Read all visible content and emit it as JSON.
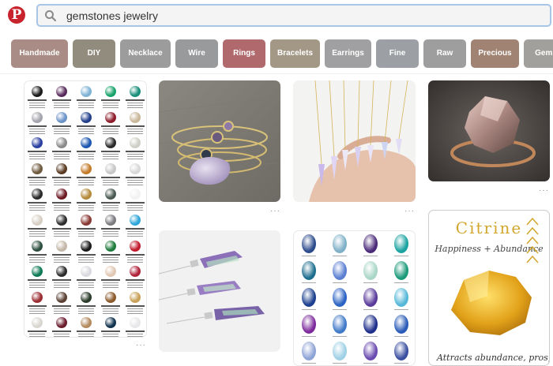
{
  "header": {
    "logo_glyph": "P",
    "search_value": "gemstones jewelry"
  },
  "chips": [
    {
      "label": "Handmade",
      "color": "#a88c85"
    },
    {
      "label": "DIY",
      "color": "#928c7f"
    },
    {
      "label": "Necklace",
      "color": "#9c9c9c"
    },
    {
      "label": "Wire",
      "color": "#999a9c"
    },
    {
      "label": "Rings",
      "color": "#b06a6e"
    },
    {
      "label": "Bracelets",
      "color": "#a39786"
    },
    {
      "label": "Earrings",
      "color": "#a0a0a2"
    },
    {
      "label": "Fine",
      "color": "#9c9fa3"
    },
    {
      "label": "Raw",
      "color": "#9e9e9e"
    },
    {
      "label": "Precious",
      "color": "#a08373"
    },
    {
      "label": "Gem S",
      "color": "#a1a09c"
    }
  ],
  "pins": {
    "citrine_title": "Citrine",
    "citrine_subtitle": "Happiness + Abundance",
    "citrine_caption": "Attracts abundance, prosperity",
    "more_glyph": "···"
  },
  "colors": {
    "accent_red": "#c8232c",
    "search_border": "#a7c5e6"
  },
  "gem_colors": [
    "#1b1b1b",
    "#5a2c5e",
    "#7fb3d6",
    "#1aa36b",
    "#1a8f7a",
    "#a4a4ad",
    "#6b93c8",
    "#233f8c",
    "#8c1c2b",
    "#c9b79a",
    "#2b3fa0",
    "#8a8a8a",
    "#1c57b0",
    "#2a2a2a",
    "#cfcfc6",
    "#6f5a3e",
    "#5a3b22",
    "#c47b2a",
    "#c7c7c7",
    "#d8d8d8",
    "#2a2a2a",
    "#6e1a23",
    "#b58a3a",
    "#4a5a52",
    "#f2f2f2",
    "#d7cfc5",
    "#2d2d2d",
    "#8a3a34",
    "#7c7b80",
    "#2fa6d9",
    "#2d4f3f",
    "#c3b7a8",
    "#1a1a1a",
    "#1e7b3b",
    "#c21b2e",
    "#0e7a55",
    "#2c2c2c",
    "#d9d9e0",
    "#e1c8b4",
    "#b0233a",
    "#9b2d33",
    "#5a4033",
    "#2b3b2a",
    "#8b5a2a",
    "#c9a15a",
    "#d8d6cf",
    "#6b1c2d",
    "#b48b5e",
    "#12344f",
    "#e7e7ea"
  ],
  "oval_colors": [
    "#2c4b8c",
    "#7fb0c8",
    "#4b2a7a",
    "#1aa3a0",
    "#1e6f8f",
    "#5b7fd1",
    "#a9d6c6",
    "#1b9a7a",
    "#1c3f8f",
    "#2b63c4",
    "#5a3b9b",
    "#55b8d9",
    "#7d2a9c",
    "#4079c8",
    "#1e2f8c",
    "#2a5bb8",
    "#8fa4d6",
    "#9fd0e6",
    "#6b4bb0",
    "#3a4fa0"
  ]
}
